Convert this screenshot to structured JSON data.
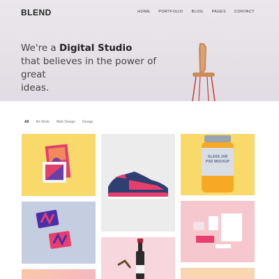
{
  "header": {
    "logo": "BLEND",
    "nav": [
      "HOME",
      "PORTFOLIO",
      "BLOG",
      "PAGES",
      "CONTACT"
    ]
  },
  "hero": {
    "line1_prefix": "We're a ",
    "line1_bold": "Digital Studio",
    "line2": "that believes in the power of great",
    "line3": "ideas."
  },
  "filters": [
    "All",
    "Art Work",
    "Web Design",
    "Design"
  ],
  "portfolio": {
    "tiles": [
      {
        "name": "pink-geometric-cards",
        "bg": "#f8d96a"
      },
      {
        "name": "sneaker",
        "bg": "#ececec"
      },
      {
        "name": "glass-jar-mockup",
        "bg": "#f8d96a"
      },
      {
        "name": "m-business-cards",
        "bg": "#c5cde0"
      },
      {
        "name": "stationery-mockup",
        "bg": "#f6c7cd"
      },
      {
        "name": "wine-bottle",
        "bg": "#f8d6de"
      },
      {
        "name": "orange-pink-card",
        "bg": "#f9c7a6"
      },
      {
        "name": "peach-card",
        "bg": "#f8d6b0"
      }
    ],
    "jar_label_line1": "GLASS JAR",
    "jar_label_line2": "PSD MOCKUP"
  },
  "colors": {
    "hero_bg": "#e6e2e8",
    "accent_yellow": "#f8d96a",
    "accent_pink": "#e0406b"
  }
}
